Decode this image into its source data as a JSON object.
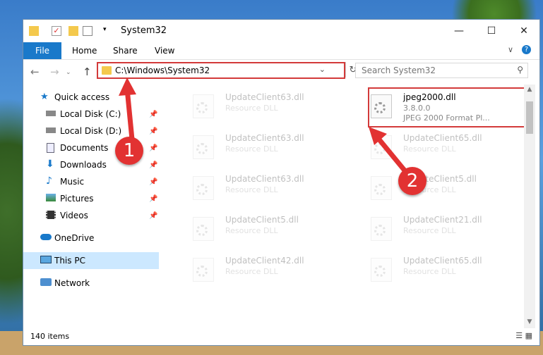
{
  "window": {
    "title": "System32",
    "minimize": "—",
    "maximize": "☐",
    "close": "✕"
  },
  "ribbon": {
    "tabs": [
      "File",
      "Home",
      "Share",
      "View"
    ],
    "collapse": "∨",
    "help": "?"
  },
  "address": {
    "path": "C:\\Windows\\System32",
    "search_placeholder": "Search System32"
  },
  "nav": {
    "items": [
      {
        "label": "Quick access",
        "icon": "star-icon"
      },
      {
        "label": "Local Disk (C:)",
        "icon": "drive-icon",
        "pinned": true
      },
      {
        "label": "Local Disk (D:)",
        "icon": "drive-icon",
        "pinned": true
      },
      {
        "label": "Documents",
        "icon": "documents-icon",
        "pinned": true
      },
      {
        "label": "Downloads",
        "icon": "download-icon",
        "pinned": true
      },
      {
        "label": "Music",
        "icon": "music-icon",
        "pinned": true
      },
      {
        "label": "Pictures",
        "icon": "pictures-icon",
        "pinned": true
      },
      {
        "label": "Videos",
        "icon": "videos-icon",
        "pinned": true
      },
      {
        "label": "OneDrive",
        "icon": "cloud-icon"
      },
      {
        "label": "This PC",
        "icon": "computer-icon",
        "selected": true
      },
      {
        "label": "Network",
        "icon": "network-icon"
      }
    ]
  },
  "files": {
    "left": [
      {
        "name": "UpdateClient63.dll",
        "type": "Resource DLL"
      },
      {
        "name": "UpdateClient63.dll",
        "type": "Resource DLL"
      },
      {
        "name": "UpdateClient63.dll",
        "type": "Resource DLL"
      },
      {
        "name": "UpdateClient5.dll",
        "type": "Resource DLL"
      },
      {
        "name": "UpdateClient42.dll",
        "type": "Resource DLL"
      }
    ],
    "right": [
      {
        "name": "jpeg2000.dll",
        "version": "3.8.0.0",
        "type": "JPEG 2000 Format Pl..."
      },
      {
        "name": "UpdateClient65.dll",
        "type": "Resource DLL"
      },
      {
        "name": "UpdateClient5.dll",
        "type": "Resource DLL"
      },
      {
        "name": "UpdateClient21.dll",
        "type": "Resource DLL"
      },
      {
        "name": "UpdateClient65.dll",
        "type": "Resource DLL"
      }
    ]
  },
  "status": {
    "count": "140 items"
  },
  "annotations": {
    "step1": "1",
    "step2": "2",
    "color": "#e23232"
  }
}
